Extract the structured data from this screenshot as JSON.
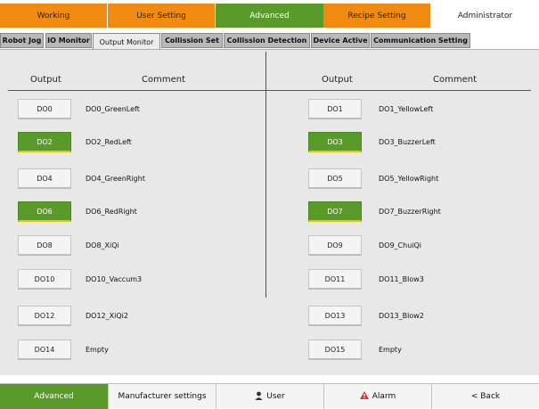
{
  "top_tabs": {
    "working": "Working",
    "user_setting": "User Setting",
    "advanced": "Advanced",
    "recipe_setting": "Recipe Setting",
    "administrator": "Administrator"
  },
  "sub_tabs": {
    "robot_jog": "Robot Jog",
    "io_monitor": "IO Monitor",
    "output_monitor": "Output Monitor",
    "collision_set": "Collission Set",
    "collision_detection": "Collission Detection",
    "device_active": "Device Active",
    "communication_setting": "Communication Setting"
  },
  "headers": {
    "output_left": "Output",
    "comment_left": "Comment",
    "output_right": "Output",
    "comment_right": "Comment"
  },
  "outputs": [
    {
      "id": "DO0",
      "comment": "DO0_GreenLeft",
      "on": false
    },
    {
      "id": "DO1",
      "comment": "DO1_YellowLeft",
      "on": false
    },
    {
      "id": "DO2",
      "comment": "DO2_RedLeft",
      "on": true
    },
    {
      "id": "DO3",
      "comment": "DO3_BuzzerLeft",
      "on": true
    },
    {
      "id": "DO4",
      "comment": "DO4_GreenRight",
      "on": false
    },
    {
      "id": "DO5",
      "comment": "DO5_YellowRight",
      "on": false
    },
    {
      "id": "DO6",
      "comment": "DO6_RedRight",
      "on": true
    },
    {
      "id": "DO7",
      "comment": "DO7_BuzzerRight",
      "on": true
    },
    {
      "id": "DO8",
      "comment": "DO8_XiQi",
      "on": false
    },
    {
      "id": "DO9",
      "comment": "DO9_ChuiQi",
      "on": false
    },
    {
      "id": "DO10",
      "comment": "DO10_Vaccum3",
      "on": false
    },
    {
      "id": "DO11",
      "comment": "DO11_Blow3",
      "on": false
    },
    {
      "id": "DO12",
      "comment": "DO12_XiQi2",
      "on": false
    },
    {
      "id": "DO13",
      "comment": "DO13_Blow2",
      "on": false
    },
    {
      "id": "DO14",
      "comment": "Empty",
      "on": false
    },
    {
      "id": "DO15",
      "comment": "Empty",
      "on": false
    }
  ],
  "bottom_bar": {
    "advanced": "Advanced",
    "manufacturer_settings": "Manufacturer settings",
    "user": "User",
    "alarm": "Alarm",
    "back": "< Back"
  },
  "icons": {
    "user_icon": "user-icon",
    "alarm_icon": "alarm-icon"
  },
  "colors": {
    "orange_tab": "#f08a10",
    "active_green": "#5a9a2a",
    "indicator_yellow": "#e8c020",
    "alarm_red": "#dd3333"
  }
}
